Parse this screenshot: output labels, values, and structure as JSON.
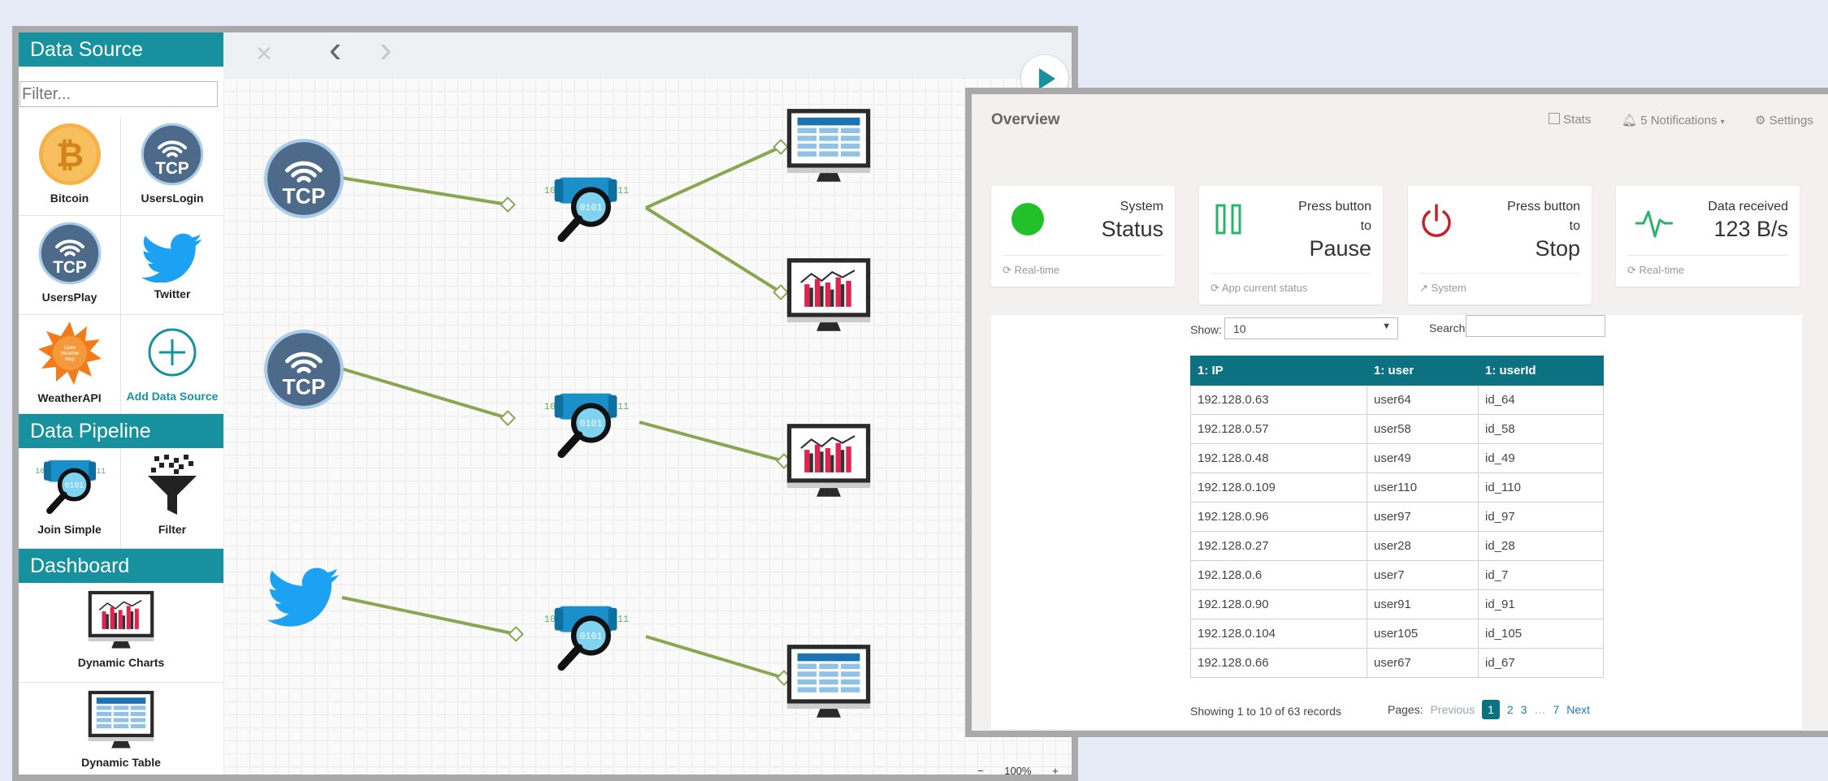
{
  "sidebar": {
    "data_source_title": "Data Source",
    "filter_placeholder": "Filter...",
    "data_sources": [
      {
        "label": "Bitcoin",
        "icon": "bitcoin-icon"
      },
      {
        "label": "UsersLogin",
        "icon": "tcp-icon"
      },
      {
        "label": "UsersPlay",
        "icon": "tcp-icon"
      },
      {
        "label": "Twitter",
        "icon": "twitter-icon"
      },
      {
        "label": "WeatherAPI",
        "icon": "weather-sun-icon"
      },
      {
        "label": "Add Data Source",
        "icon": "plus-circle-icon"
      }
    ],
    "weather_logo_text": "Open Weather Map",
    "data_pipeline_title": "Data Pipeline",
    "pipeline_tools": [
      {
        "label": "Join Simple",
        "icon": "join-magnifier-icon"
      },
      {
        "label": "Filter",
        "icon": "funnel-icon"
      }
    ],
    "dashboard_title": "Dashboard",
    "dashboard_tools": [
      {
        "label": "Dynamic Charts",
        "icon": "chart-monitor-icon"
      },
      {
        "label": "Dynamic Table",
        "icon": "table-monitor-icon"
      }
    ]
  },
  "toolbar": {
    "close": "×",
    "back": "‹",
    "forward": "›"
  },
  "canvas": {
    "tcp_text": "TCP",
    "join_bits": "0101"
  },
  "zoom": {
    "minus": "−",
    "level": "100%",
    "plus": "+"
  },
  "overview": {
    "title": "Overview",
    "nav": {
      "stats": "Stats",
      "notifications": "5 Notifications",
      "settings": "Settings"
    },
    "cards": [
      {
        "small": "System",
        "big": "Status",
        "footer": "Real-time"
      },
      {
        "small": "Press button to",
        "big": "Pause",
        "footer": "App current status"
      },
      {
        "small": "Press button to",
        "big": "Stop",
        "footer": "System"
      },
      {
        "small": "Data received",
        "big": "123 B/s",
        "footer": "Real-time"
      }
    ],
    "colors": {
      "status_green": "#22c02b",
      "teal": "#17919e",
      "stop_red": "#c0242c",
      "pulse_green": "#2cb36b"
    },
    "table": {
      "show_label": "Show:",
      "show_value": "10",
      "search_label": "Search:",
      "headers": [
        "1: IP",
        "1: user",
        "1: userId"
      ],
      "rows": [
        [
          "192.128.0.63",
          "user64",
          "id_64"
        ],
        [
          "192.128.0.57",
          "user58",
          "id_58"
        ],
        [
          "192.128.0.48",
          "user49",
          "id_49"
        ],
        [
          "192.128.0.109",
          "user110",
          "id_110"
        ],
        [
          "192.128.0.96",
          "user97",
          "id_97"
        ],
        [
          "192.128.0.27",
          "user28",
          "id_28"
        ],
        [
          "192.128.0.6",
          "user7",
          "id_7"
        ],
        [
          "192.128.0.90",
          "user91",
          "id_91"
        ],
        [
          "192.128.0.104",
          "user105",
          "id_105"
        ],
        [
          "192.128.0.66",
          "user67",
          "id_67"
        ]
      ],
      "records_info": "Showing 1 to 10 of 63 records",
      "pager": {
        "label": "Pages:",
        "previous": "Previous",
        "pages": [
          "1",
          "2",
          "3",
          "…",
          "7"
        ],
        "next": "Next"
      }
    }
  }
}
